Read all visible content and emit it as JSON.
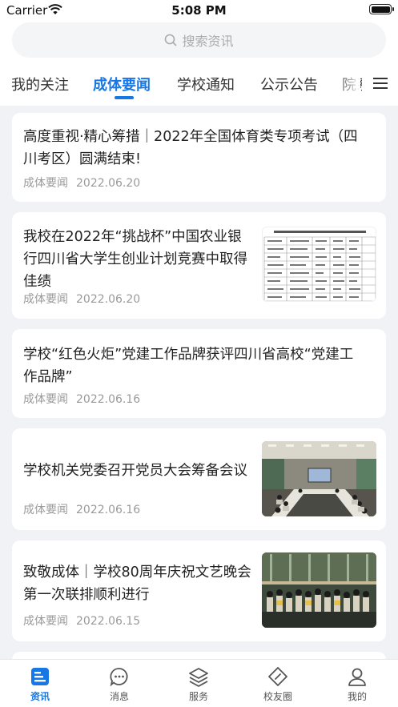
{
  "status_bar": {
    "carrier": "Carrier",
    "time": "5:08 PM"
  },
  "search": {
    "placeholder": "搜索资讯"
  },
  "tabs": [
    {
      "label": "我的关注",
      "active": false
    },
    {
      "label": "成体要闻",
      "active": true
    },
    {
      "label": "学校通知",
      "active": false
    },
    {
      "label": "公示公告",
      "active": false
    },
    {
      "label": "院系",
      "active": false
    }
  ],
  "colors": {
    "accent": "#1677e5",
    "background": "#f1f2f5"
  },
  "articles": [
    {
      "title_lines": [
        "高度重视·精心筹措｜2022年全国体育类专项考试（四",
        "川考区）圆满结束!"
      ],
      "category": "成体要闻",
      "date": "2022.06.20",
      "thumbnail": null
    },
    {
      "title_lines": [
        "我校在2022年“挑战杯”中国农业银",
        "行四川省大学生创业计划竞赛中取得",
        "佳绩"
      ],
      "category": "成体要闻",
      "date": "2022.06.20",
      "thumbnail": "document-table-image"
    },
    {
      "title_lines": [
        "学校“红色火炬”党建工作品牌获评四川省高校“党建工",
        "作品牌”"
      ],
      "category": "成体要闻",
      "date": "2022.06.16",
      "thumbnail": null
    },
    {
      "title_lines": [
        "学校机关党委召开党员大会筹备会议"
      ],
      "category": "成体要闻",
      "date": "2022.06.16",
      "thumbnail": "meeting-room-photo"
    },
    {
      "title_lines": [
        "致敬成体｜学校80周年庆祝文艺晚会",
        "第一次联排顺利进行"
      ],
      "category": "成体要闻",
      "date": "2022.06.15",
      "thumbnail": "stage-performance-photo"
    }
  ],
  "tabbar": [
    {
      "label": "资讯",
      "icon": "news-icon",
      "active": true
    },
    {
      "label": "消息",
      "icon": "message-icon",
      "active": false
    },
    {
      "label": "服务",
      "icon": "layers-icon",
      "active": false
    },
    {
      "label": "校友圈",
      "icon": "compass-icon",
      "active": false
    },
    {
      "label": "我的",
      "icon": "profile-icon",
      "active": false
    }
  ]
}
